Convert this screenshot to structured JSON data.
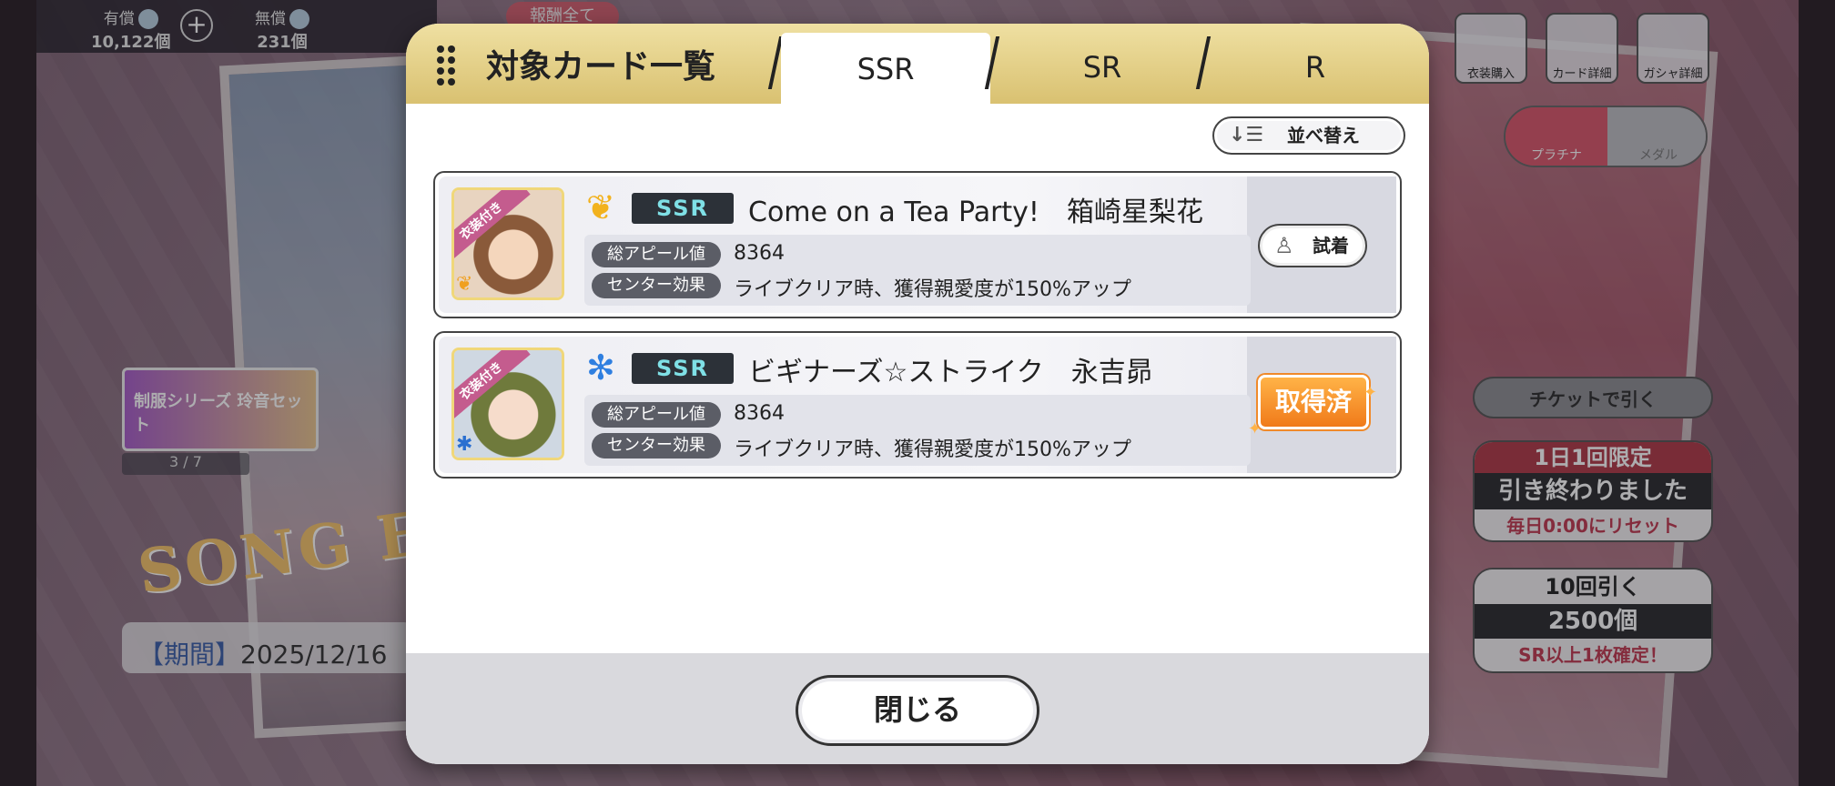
{
  "header": {
    "paid_label": "有償",
    "paid_value": "10,122個",
    "free_label": "無償",
    "free_value": "231個",
    "reward_label": "報酬全て"
  },
  "bg_buttons": [
    {
      "label": "衣装購入",
      "icon": "dress-icon"
    },
    {
      "label": "カード詳細",
      "icon": "card-detail-icon"
    },
    {
      "label": "ガシャ詳細",
      "icon": "gacha-detail-icon"
    }
  ],
  "gacha_toggle": {
    "platinum": "プラチナ",
    "medal": "メダル"
  },
  "ticket_button": "チケットで引く",
  "daily": {
    "top": "1日1回限定",
    "mid": "引き終わりました",
    "bot": "毎日0:00にリセット"
  },
  "ten_pull": {
    "top": "10回引く",
    "mid": "2500個",
    "bot": "SR以上1枚確定！"
  },
  "banner": {
    "label": "制服シリーズ 玲音セット",
    "page": "3 / 7",
    "logo": "SONG FOR",
    "period_label": "【期間】",
    "period_value": "2025/12/16"
  },
  "modal": {
    "title": "対象カード一覧",
    "tabs": [
      {
        "label": "SSR",
        "active": true
      },
      {
        "label": "SR",
        "active": false
      },
      {
        "label": "R",
        "active": false
      }
    ],
    "sort_label": "並べ替え",
    "close_label": "閉じる",
    "cards": [
      {
        "rarity": "SSR",
        "name": "Come on a Tea Party!　箱崎星梨花",
        "attribute_icon": "angel-wing-icon",
        "costume_tag": "衣装付き",
        "appeal_label": "総アピール値",
        "appeal_value": "8364",
        "center_label": "センター効果",
        "center_value": "ライブクリア時、獲得親愛度が150%アップ",
        "action": "try",
        "action_label": "試着"
      },
      {
        "rarity": "SSR",
        "name": "ビギナーズ☆ストライク　永吉昴",
        "attribute_icon": "snowflake-icon",
        "costume_tag": "衣装付き",
        "appeal_label": "総アピール値",
        "appeal_value": "8364",
        "center_label": "センター効果",
        "center_value": "ライブクリア時、獲得親愛度が150%アップ",
        "action": "owned",
        "action_label": "取得済"
      }
    ]
  },
  "colors": {
    "header_gold": "#d9c171",
    "rarity_bg": "#2c3138",
    "owned_orange": "#f07a1a",
    "accent_red": "#d9566a"
  }
}
